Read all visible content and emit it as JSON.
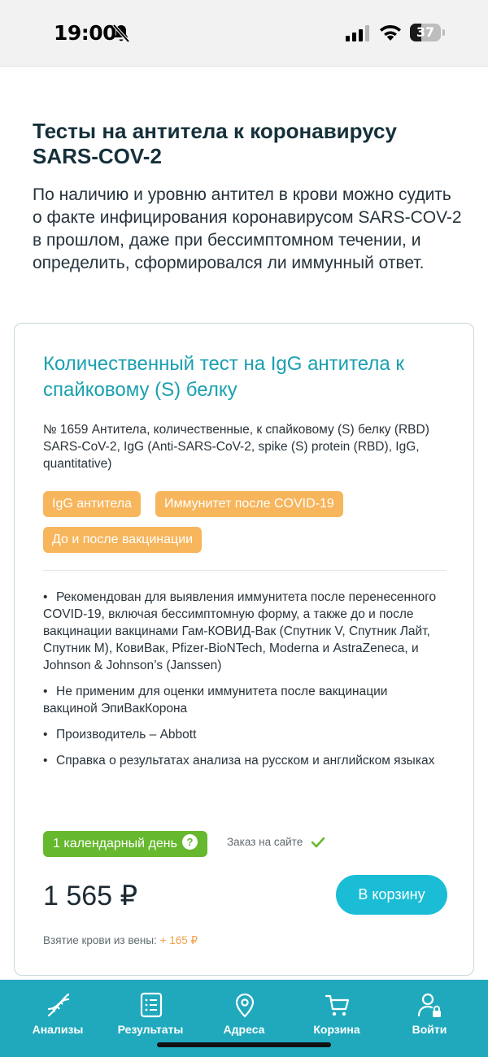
{
  "status_bar": {
    "time": "19:00",
    "battery_level": "37"
  },
  "intro": {
    "title": "Тесты на антитела к коронавирусу SARS-COV-2",
    "description": "По наличию и уровню антител в крови можно судить о факте инфицирования коронавирусом SARS-COV-2 в прошлом, даже при бессимптомном течении, и определить, сформировался ли иммунный ответ."
  },
  "card": {
    "title": "Количественный тест на IgG антитела к спайковому (S) белку",
    "code_description": "№ 1659 Антитела, количественные, к спайковому (S) белку (RBD) SARS-CoV-2, IgG (Anti-SARS-CoV-2, spike (S) protein (RBD), IgG, quantitative)",
    "tags": [
      "IgG антитела",
      "Иммунитет после COVID-19",
      "До и после вакцинации"
    ],
    "tag_color": "#f7b55c",
    "features": [
      "Рекомендован для выявления иммунитета после перенесенного COVID-19, включая бессимптомную форму, а также до и после вакцинации вакцинами Гам-КОВИД-Вак (Спутник V, Спутник Лайт, Спутник М), КовиВак, Pfizer-BioNTech, Moderna и AstraZeneca, и Johnson & Johnson’s (Janssen)",
      "Не применим для оценки иммунитета после вакцинации вакциной ЭпиВакКорона",
      "Производитель – Abbott",
      "Справка о результатах анализа на русском и английском языках"
    ],
    "bullet": "•",
    "duration": "1 календарный день",
    "duration_help": "?",
    "order_online": "Заказ на сайте",
    "price": "1 565 ₽",
    "cart_button": "В корзину",
    "blood_draw_label": "Взятие крови из вены:",
    "blood_draw_price": "+ 165 ₽",
    "accent_color": "#1aa0b0"
  },
  "bottom_nav": {
    "background": "#20a9bd",
    "items": [
      {
        "label": "Анализы",
        "icon": "dna-icon"
      },
      {
        "label": "Результаты",
        "icon": "results-list-icon"
      },
      {
        "label": "Адреса",
        "icon": "location-pin-icon"
      },
      {
        "label": "Корзина",
        "icon": "cart-icon"
      },
      {
        "label": "Войти",
        "icon": "user-lock-icon"
      }
    ]
  }
}
